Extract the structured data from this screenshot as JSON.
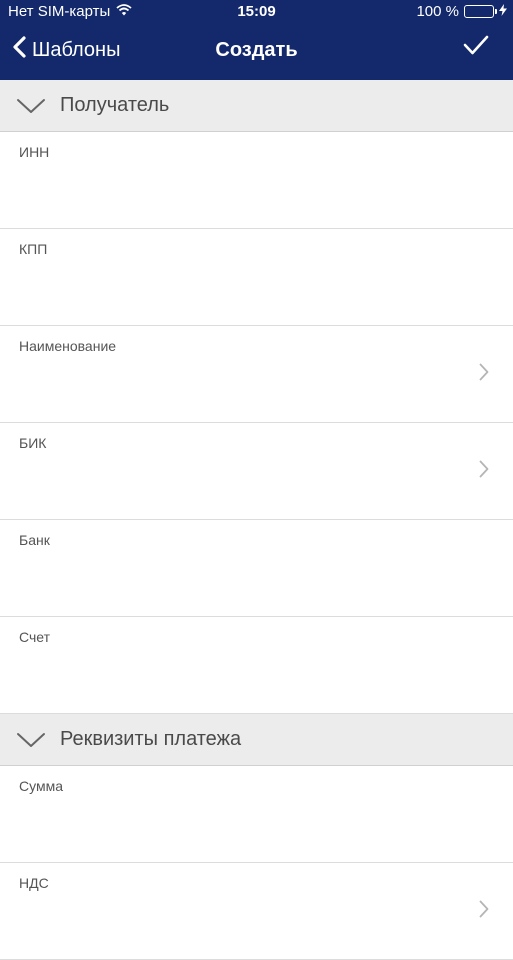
{
  "status_bar": {
    "carrier": "Нет SIM-карты",
    "time": "15:09",
    "battery": "100 %",
    "icons": [
      "wifi-icon",
      "battery-icon",
      "charging-icon"
    ]
  },
  "nav": {
    "back_label": "Шаблоны",
    "title": "Создать",
    "done_icon": "checkmark-icon"
  },
  "sections": [
    {
      "title": "Получатель",
      "fields": [
        {
          "label": "ИНН",
          "has_arrow": false
        },
        {
          "label": "КПП",
          "has_arrow": false
        },
        {
          "label": "Наименование",
          "has_arrow": true
        },
        {
          "label": "БИК",
          "has_arrow": true
        },
        {
          "label": "Банк",
          "has_arrow": false
        },
        {
          "label": "Счет",
          "has_arrow": false
        }
      ]
    },
    {
      "title": "Реквизиты платежа",
      "fields": [
        {
          "label": "Сумма",
          "has_arrow": false
        },
        {
          "label": "НДС",
          "has_arrow": true
        }
      ]
    }
  ],
  "colors": {
    "nav_background": "#14296b",
    "section_background": "#ececec",
    "battery_fill": "#2ecc40"
  }
}
